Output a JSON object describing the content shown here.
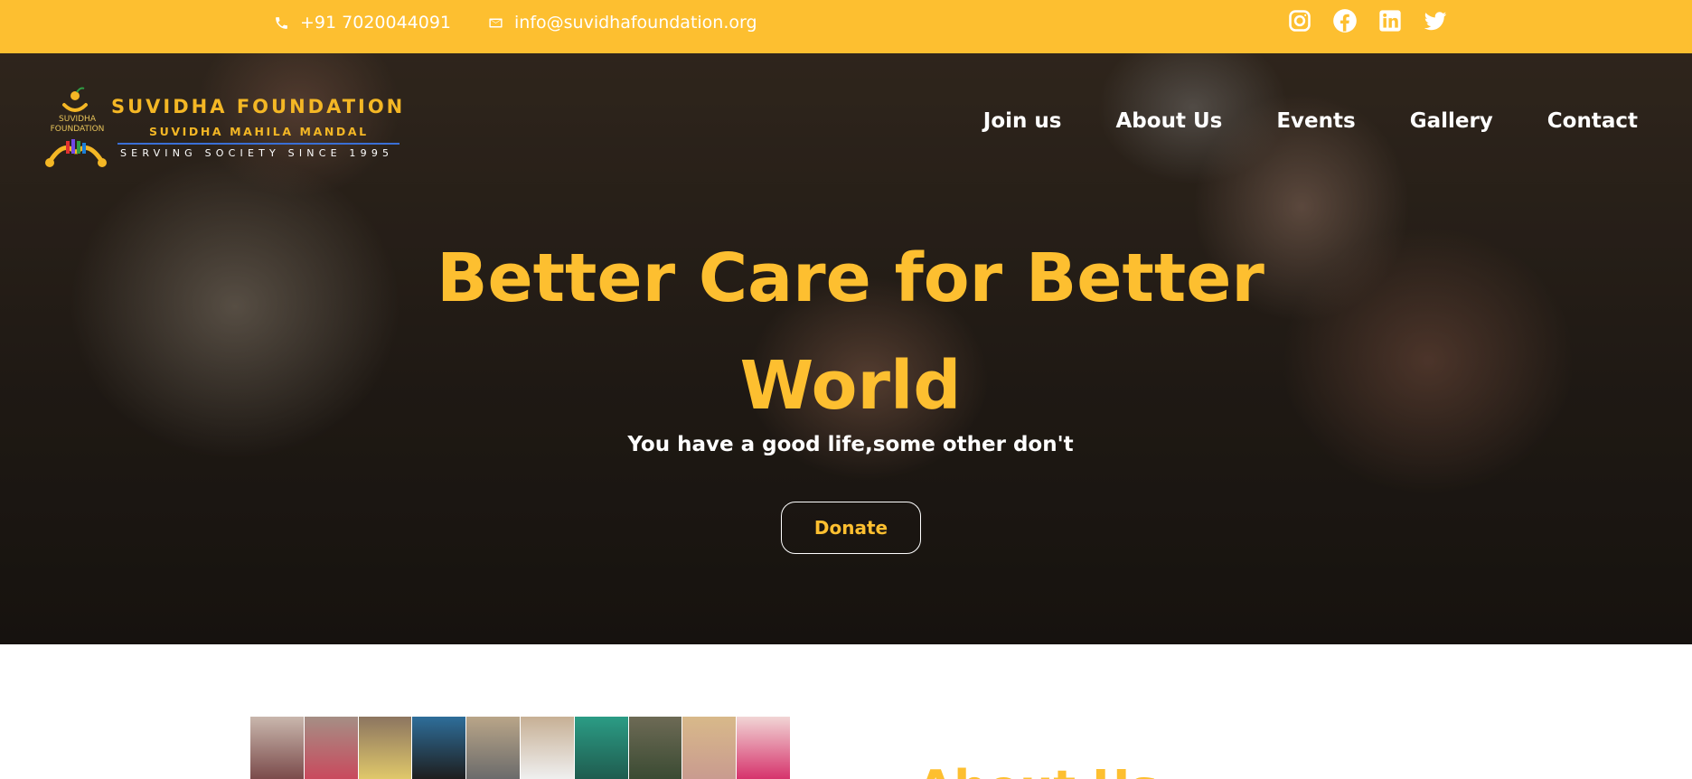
{
  "topbar": {
    "phone": "+91 7020044091",
    "email": "info@suvidhafoundation.org",
    "phone_icon": "phone-icon",
    "email_icon": "mail-icon",
    "socials": [
      "instagram-icon",
      "facebook-icon",
      "linkedin-icon",
      "twitter-icon"
    ],
    "background_color": "#fdbf30"
  },
  "logo": {
    "emblem_text": "SUVIDHA FOUNDATION",
    "brand": "SUVIDHA FOUNDATION",
    "subtitle": "SUVIDHA MAHILA MANDAL",
    "tagline": "SERVING SOCIETY SINCE 1995"
  },
  "nav": {
    "items": [
      "Join us",
      "About Us",
      "Events",
      "Gallery",
      "Contact"
    ]
  },
  "hero": {
    "title": "Better Care for Better World",
    "subtitle": "You have a good life,some other don't",
    "donate_label": "Donate",
    "accent_color": "#fdbf30"
  },
  "below": {
    "heading_fragment": "About Us"
  }
}
